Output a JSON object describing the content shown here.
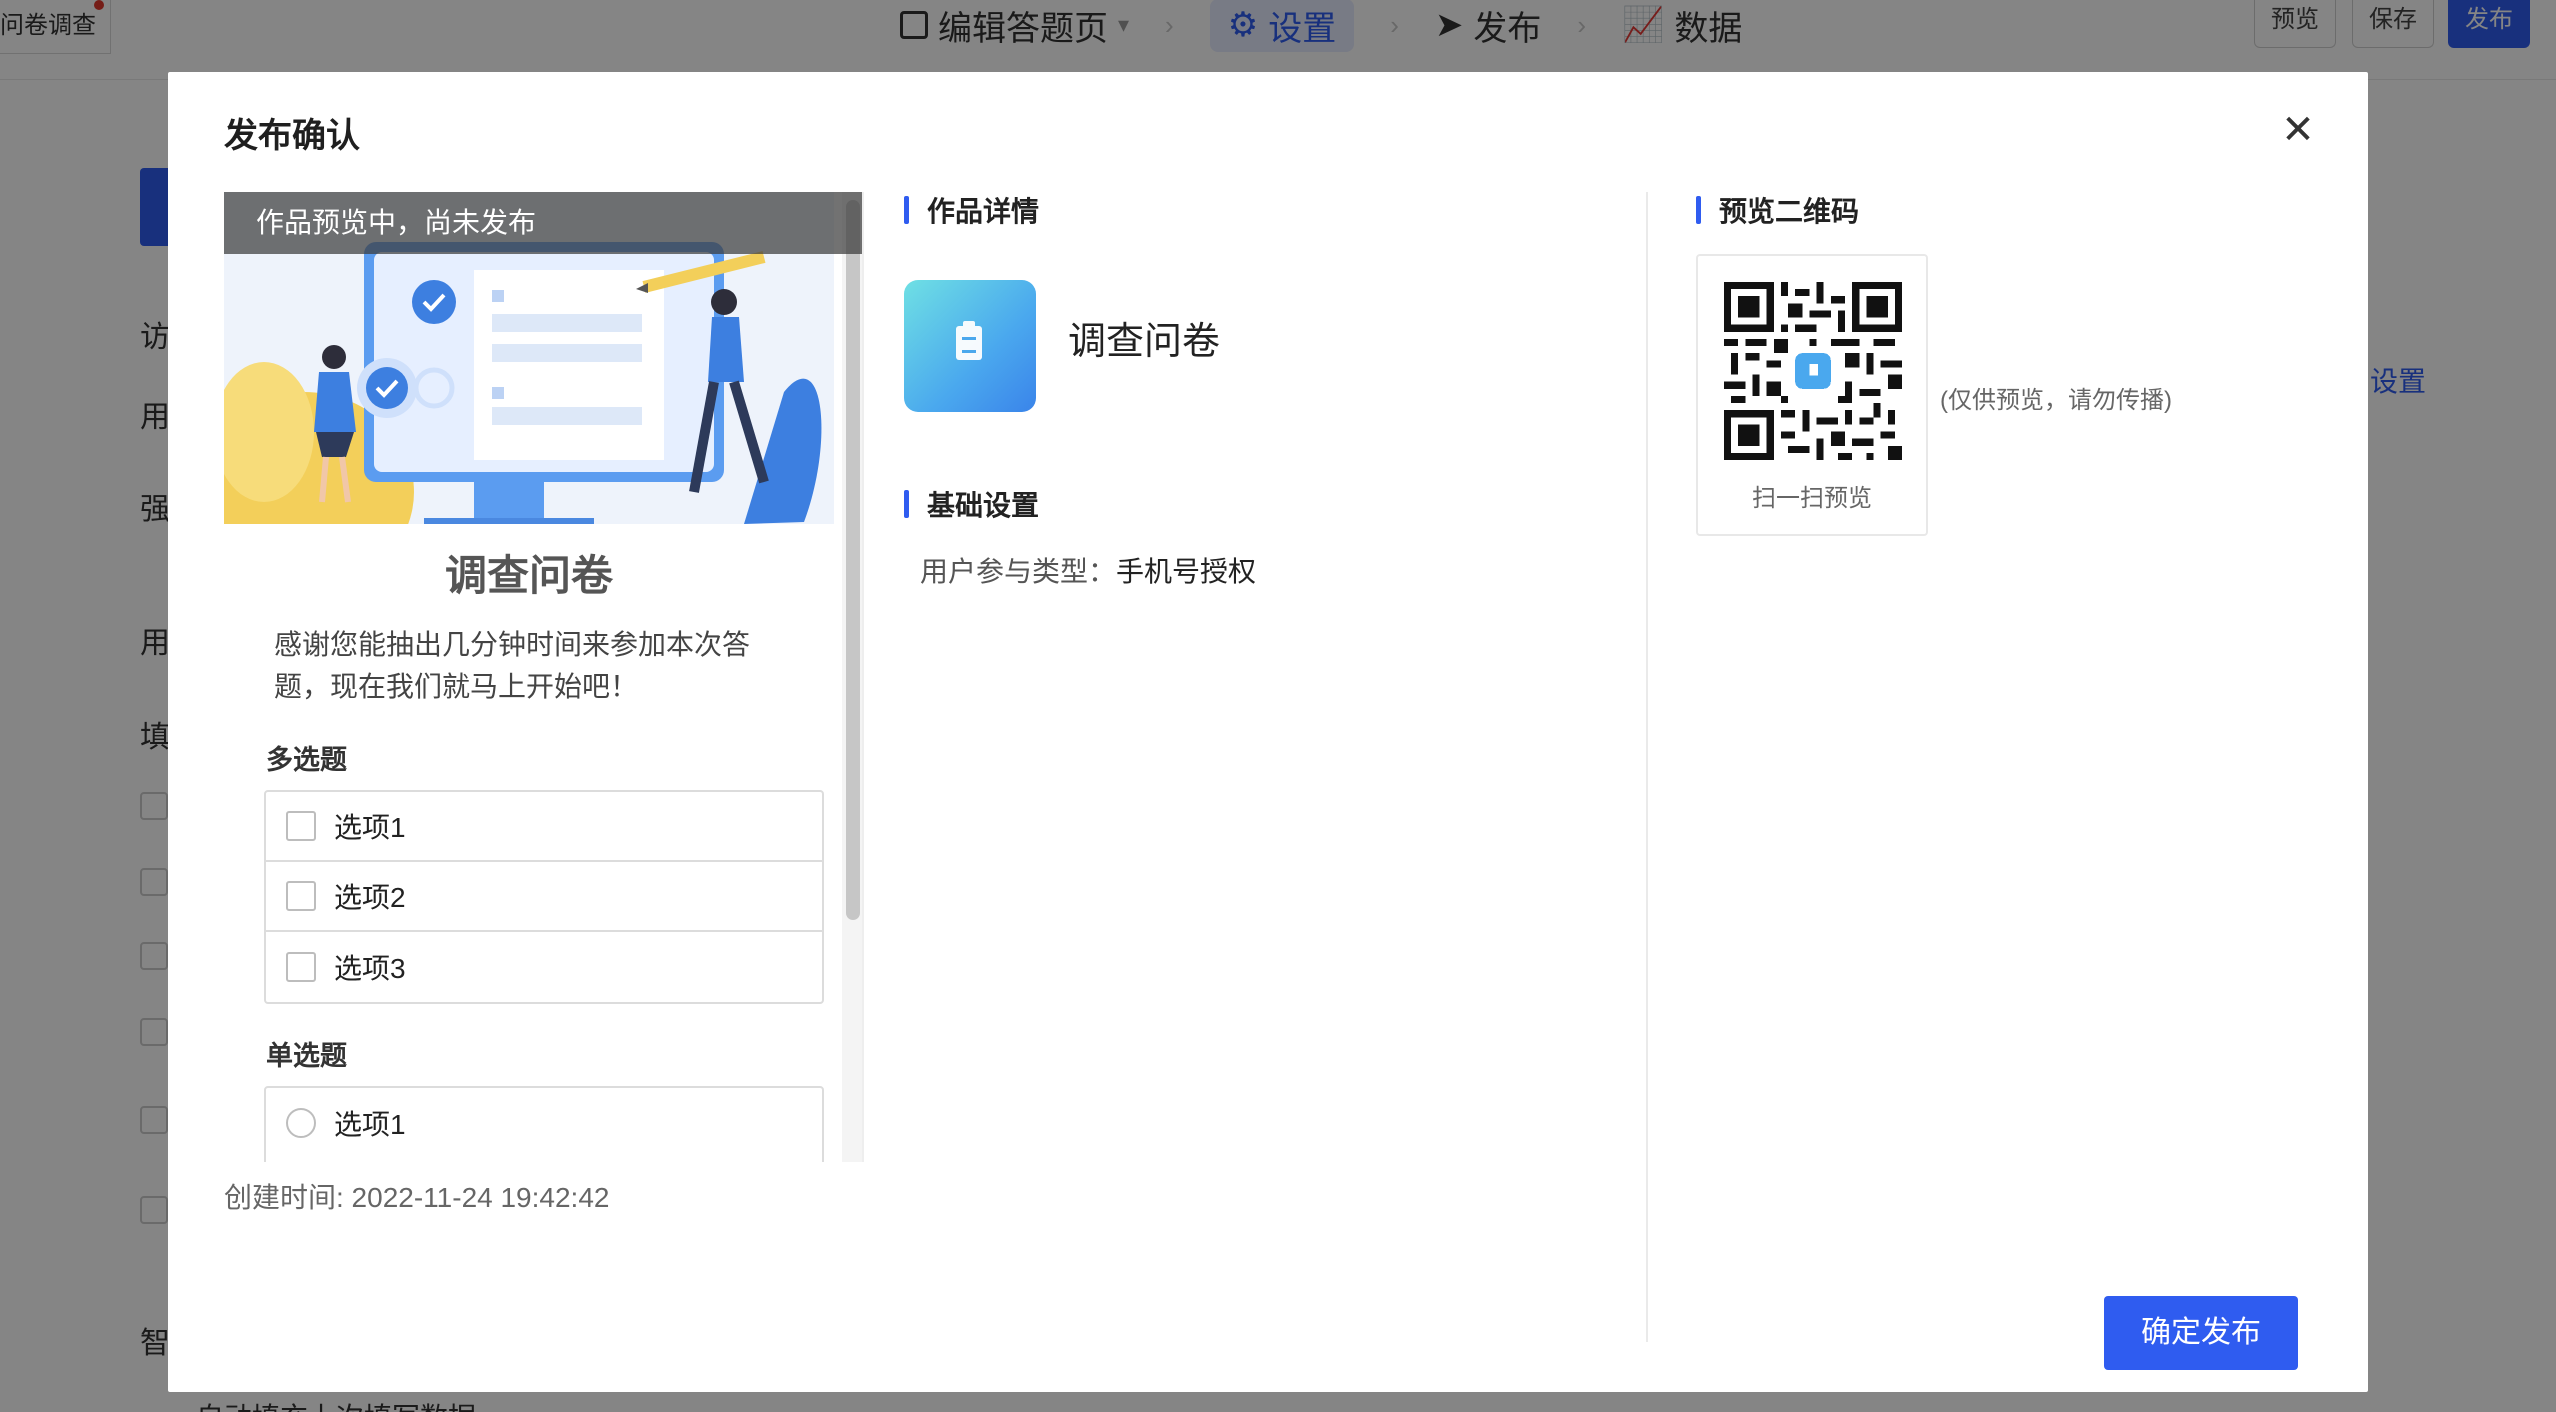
{
  "background": {
    "tab_title": "问卷调查",
    "steps": [
      {
        "label": "编辑答题页",
        "active": false
      },
      {
        "label": "设置",
        "active": true
      },
      {
        "label": "发布",
        "active": false
      },
      {
        "label": "数据",
        "active": false
      }
    ],
    "buttons": {
      "preview": "预览",
      "save": "保存",
      "publish": "发布"
    },
    "side_texts": [
      "访",
      "用",
      "强",
      "用",
      "填",
      "智"
    ],
    "right_link": "设置",
    "bottom_text": "自动填充上次填写数据"
  },
  "modal": {
    "title": "发布确认",
    "close_icon": "close-icon",
    "preview": {
      "banner": "作品预览中，尚未发布",
      "survey_title": "调查问卷",
      "description": "感谢您能抽出几分钟时间来参加本次答题，现在我们就马上开始吧！",
      "questions": [
        {
          "label": "多选题",
          "type": "checkbox",
          "options": [
            "选项1",
            "选项2",
            "选项3"
          ]
        },
        {
          "label": "单选题",
          "type": "radio",
          "options": [
            "选项1"
          ]
        }
      ]
    },
    "created_time": "创建时间: 2022-11-24 19:42:42",
    "work_details": {
      "heading": "作品详情",
      "name": "调查问卷",
      "icon": "clipboard-icon"
    },
    "basic_settings": {
      "heading": "基础设置",
      "participation_label": "用户参与类型：",
      "participation_value": "手机号授权"
    },
    "qr": {
      "heading": "预览二维码",
      "caption": "扫一扫预览",
      "note": "(仅供预览，请勿传播)"
    },
    "confirm_button": "确定发布",
    "colors": {
      "accent": "#2f5cf0",
      "overlay": "rgba(0,0,0,0.48)"
    }
  }
}
